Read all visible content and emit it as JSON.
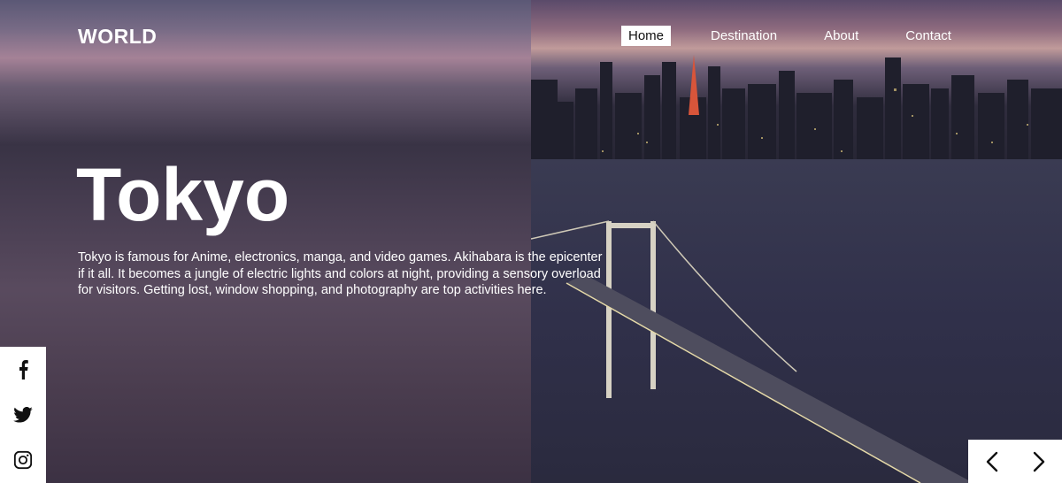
{
  "header": {
    "logo": "WORLD",
    "nav": [
      {
        "label": "Home",
        "active": true
      },
      {
        "label": "Destination",
        "active": false
      },
      {
        "label": "About",
        "active": false
      },
      {
        "label": "Contact",
        "active": false
      }
    ]
  },
  "hero": {
    "title": "Tokyo",
    "description": "Tokyo is famous for Anime, electronics, manga, and video games. Akihabara is the epicenter if it all. It becomes a jungle of electric lights and colors at night, providing a sensory overload for visitors. Getting lost, window shopping, and photography are top activities here."
  },
  "social": {
    "icons": [
      "facebook-icon",
      "twitter-icon",
      "instagram-icon"
    ]
  },
  "slider": {
    "icons": [
      "chevron-left-icon",
      "chevron-right-icon"
    ]
  },
  "colors": {
    "accent": "#ffffff",
    "text": "#ffffff",
    "icon": "#111111"
  }
}
